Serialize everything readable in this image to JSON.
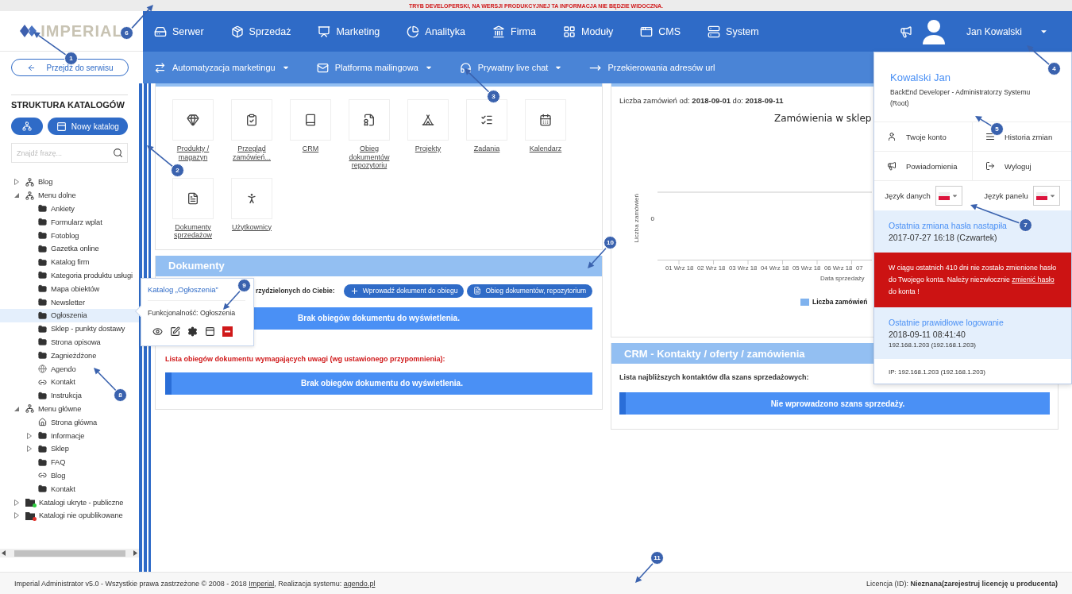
{
  "dev_notice": "TRYB DEVELOPERSKI, NA WERSJI PRODUKCYJNEJ TA INFORMACJA NIE BĘDZIE WIDOCZNA.",
  "logo": "IMPERIAL",
  "nav": [
    {
      "label": "Serwer"
    },
    {
      "label": "Sprzedaż"
    },
    {
      "label": "Marketing"
    },
    {
      "label": "Analityka"
    },
    {
      "label": "Firma"
    },
    {
      "label": "Moduły"
    },
    {
      "label": "CMS"
    },
    {
      "label": "System"
    }
  ],
  "user": {
    "name": "Jan Kowalski"
  },
  "back_button": "Przejdź do serwisu",
  "subnav": [
    {
      "label": "Automatyzacja marketingu",
      "dropdown": true
    },
    {
      "label": "Platforma mailingowa",
      "dropdown": true
    },
    {
      "label": "Prywatny live chat",
      "dropdown": true
    },
    {
      "label": "Przekierowania adresów url",
      "dropdown": false
    }
  ],
  "sidebar": {
    "title": "STRUKTURA KATALOGÓW",
    "new_button": "Nowy katalog",
    "search": {
      "placeholder": "Znajdź frazę..."
    },
    "tree": [
      {
        "label": "Blog",
        "kind": "sitemap",
        "expanded": false,
        "selected": false
      },
      {
        "label": "Menu dolne",
        "kind": "sitemap",
        "expanded": true,
        "selected": false,
        "children": [
          {
            "label": "Ankiety",
            "kind": "folder",
            "selected": false
          },
          {
            "label": "Formularz wplat",
            "kind": "folder",
            "selected": false
          },
          {
            "label": "Fotoblog",
            "kind": "folder",
            "selected": false
          },
          {
            "label": "Gazetka online",
            "kind": "folder",
            "selected": false
          },
          {
            "label": "Katalog firm",
            "kind": "folder",
            "selected": false
          },
          {
            "label": "Kategoria produktu usługi",
            "kind": "folder",
            "selected": false
          },
          {
            "label": "Mapa obiektów",
            "kind": "folder",
            "selected": false
          },
          {
            "label": "Newsletter",
            "kind": "folder",
            "selected": false
          },
          {
            "label": "Ogłoszenia",
            "kind": "folder",
            "selected": true
          },
          {
            "label": "Sklep - punkty dostawy",
            "kind": "folder",
            "selected": false
          },
          {
            "label": "Strona opisowa",
            "kind": "folder",
            "selected": false
          },
          {
            "label": "Zagnieżdżone",
            "kind": "folder",
            "selected": false
          },
          {
            "label": "Agendo",
            "kind": "web-link",
            "selected": false
          },
          {
            "label": "Kontakt",
            "kind": "folder-link",
            "selected": false
          },
          {
            "label": "Instrukcja",
            "kind": "folder",
            "selected": false
          }
        ]
      },
      {
        "label": "Menu główne",
        "kind": "sitemap",
        "expanded": true,
        "selected": false,
        "children": [
          {
            "label": "Strona główna",
            "kind": "home-link",
            "selected": false
          },
          {
            "label": "Informacje",
            "kind": "folder",
            "expanded": false,
            "selected": false
          },
          {
            "label": "Sklep",
            "kind": "folder",
            "expanded": false,
            "selected": false
          },
          {
            "label": "FAQ",
            "kind": "folder",
            "selected": false
          },
          {
            "label": "Blog",
            "kind": "folder-link",
            "selected": false
          },
          {
            "label": "Kontakt",
            "kind": "folder",
            "selected": false
          }
        ]
      },
      {
        "label": "Katalogi ukryte - publiczne",
        "kind": "folder-dot",
        "color": "#2ecc40",
        "expanded": false,
        "selected": false
      },
      {
        "label": "Katalogi nie opublikowane",
        "kind": "folder-dot",
        "color": "#e0302a",
        "expanded": false,
        "selected": false
      }
    ]
  },
  "popover": {
    "title": "Katalog „Ogłoszenia”",
    "functionality": "Funkcjonalność: Ogłoszenia"
  },
  "tiles": [
    {
      "label": "Produkty / magazyn"
    },
    {
      "label": "Przegląd zamówień..."
    },
    {
      "label": "CRM"
    },
    {
      "label": "Obieg dokumentów repozytoriu"
    },
    {
      "label": "Projekty"
    },
    {
      "label": "Zadania"
    },
    {
      "label": "Kalendarz"
    },
    {
      "label": "Dokumenty sprzedażow"
    },
    {
      "label": "Użytkownicy"
    }
  ],
  "documents": {
    "title": "Dokumenty",
    "assigned_label": "rzydzielonych do Ciebie:",
    "add_button": "Wprowadź dokument do obiegu",
    "repo_button": "Obieg dokumentów, repozytorium",
    "empty_1": "Brak obiegów dokumentu do wyświetlenia.",
    "reminder_label": "Lista obiegów dokumentu wymagających uwagi (wg ustawionego przypomnienia):",
    "empty_2": "Brak obiegów dokumentu do wyświetlenia."
  },
  "orders_chart": {
    "range": "Liczba zamówień od: **2018-09-01** do: **2018-09-11**",
    "title": "Zamówienia w sklep",
    "ylabel": "Liczba zamówień",
    "ytick": "0",
    "xlabels": [
      "01 Wrz 18",
      "02 Wrz 18",
      "03 Wrz 18",
      "04 Wrz 18",
      "05 Wrz 18",
      "06 Wrz 18",
      "07"
    ],
    "xlabel": "Data sprzedaży",
    "legend": "Liczba zamówień"
  },
  "crm": {
    "title": "CRM - Kontakty / oferty / zamówienia",
    "label": "Lista najbliższych kontaktów dla szans sprzedażowych:",
    "empty": "Nie wprowadzono szans sprzedaży."
  },
  "user_menu": {
    "name": "Kowalski Jan",
    "role": "BackEnd Developer - Administratorzy Systemu (Root)",
    "actions": [
      "Twoje konto",
      "Historia zmian",
      "Powiadomienia",
      "Wyloguj"
    ],
    "languages": [
      {
        "label": "Język danych"
      },
      {
        "label": "Język panelu"
      }
    ],
    "password_change": {
      "title": "Ostatnia zmiana hasła nastąpiła",
      "value": "2017-07-27 16:18 (Czwartek)"
    },
    "warning": {
      "before": "W ciągu ostatnich 410 dni nie zostało zmienione hasło do Twojego konta. Należy niezwłocznie",
      "link": "zmienić hasło",
      "after": "do konta !"
    },
    "last_login": {
      "title": "Ostatnie prawidłowe logowanie",
      "value": "2018-09-11 08:41:40",
      "ip": "192.168.1.203 (192.168.1.203)"
    },
    "ip": "IP: 192.168.1.203 (192.168.1.203)"
  },
  "footer": {
    "before": "Imperial Administrator v5.0 - Wszystkie prawa zastrzeżone © 2008 - 2018",
    "company_link": "Imperial",
    "middle": ", Realizacja systemu:",
    "agendo_link": "agendo.pl",
    "license": "Licencja (ID): **Nieznana(zarejestruj licencję u producenta)**"
  },
  "callouts": [
    "1",
    "2",
    "3",
    "4",
    "5",
    "6",
    "7",
    "8",
    "9",
    "10",
    "11"
  ]
}
